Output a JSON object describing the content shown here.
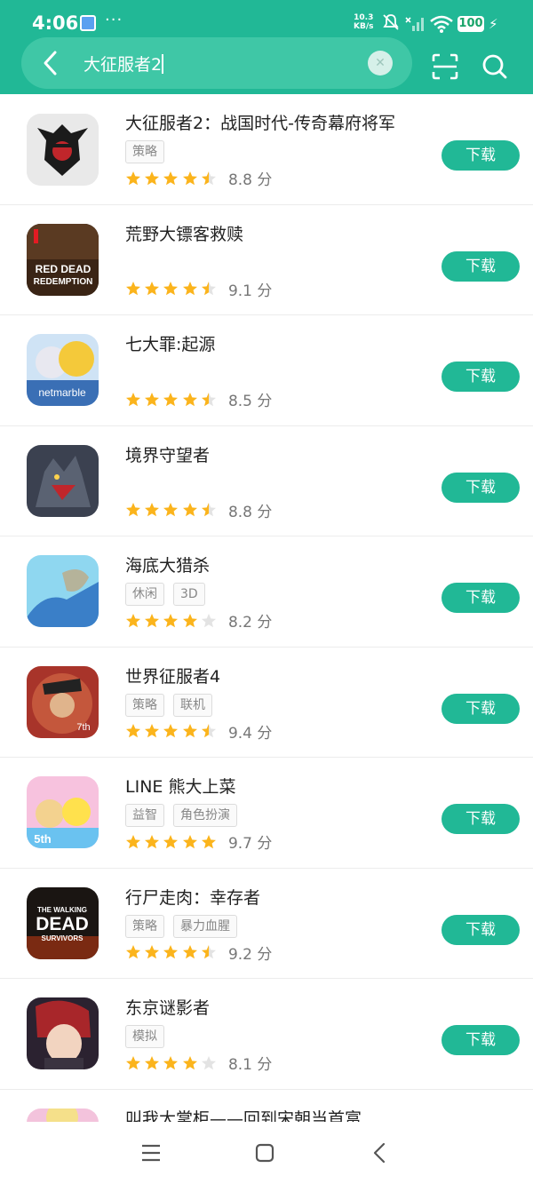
{
  "status_bar": {
    "time": "4:06",
    "more": "···",
    "net_speed_value": "10.3",
    "net_speed_unit": "KB/s",
    "battery": "100"
  },
  "search": {
    "query": "大征服者2"
  },
  "apps": [
    {
      "title": "大征服者2：战国时代-传奇幕府将军",
      "tags": [
        "策略"
      ],
      "stars": 4.5,
      "score": "8.8 分",
      "button": "下载"
    },
    {
      "title": "荒野大镖客救赎",
      "tags": [],
      "stars": 4.5,
      "score": "9.1 分",
      "button": "下载",
      "icon_text": [
        "RED DEAD",
        "REDEMPTION"
      ]
    },
    {
      "title": "七大罪:起源",
      "tags": [],
      "stars": 4.5,
      "score": "8.5 分",
      "button": "下载",
      "icon_text": [
        "netmarble"
      ]
    },
    {
      "title": "境界守望者",
      "tags": [],
      "stars": 4.5,
      "score": "8.8 分",
      "button": "下载"
    },
    {
      "title": "海底大猎杀",
      "tags": [
        "休闲",
        "3D"
      ],
      "stars": 4,
      "score": "8.2 分",
      "button": "下载"
    },
    {
      "title": "世界征服者4",
      "tags": [
        "策略",
        "联机"
      ],
      "stars": 4.5,
      "score": "9.4 分",
      "button": "下载",
      "icon_text": [
        "7th"
      ]
    },
    {
      "title": "LINE 熊大上菜",
      "tags": [
        "益智",
        "角色扮演"
      ],
      "stars": 5,
      "score": "9.7 分",
      "button": "下载",
      "icon_text": [
        "5th"
      ]
    },
    {
      "title": "行尸走肉：幸存者",
      "tags": [
        "策略",
        "暴力血腥"
      ],
      "stars": 4.5,
      "score": "9.2 分",
      "button": "下载",
      "icon_text": [
        "THE WALKING",
        "DEAD",
        "SURVIVORS"
      ]
    },
    {
      "title": "东京谜影者",
      "tags": [
        "模拟"
      ],
      "stars": 4,
      "score": "8.1 分",
      "button": "下载"
    },
    {
      "title": "叫我大掌柜——回到宋朝当首富",
      "tags": [],
      "stars": 0,
      "score": "",
      "button": ""
    }
  ],
  "colors": {
    "brand": "#21b896",
    "star": "#fbb41c",
    "star_empty": "#e3e3e3"
  }
}
